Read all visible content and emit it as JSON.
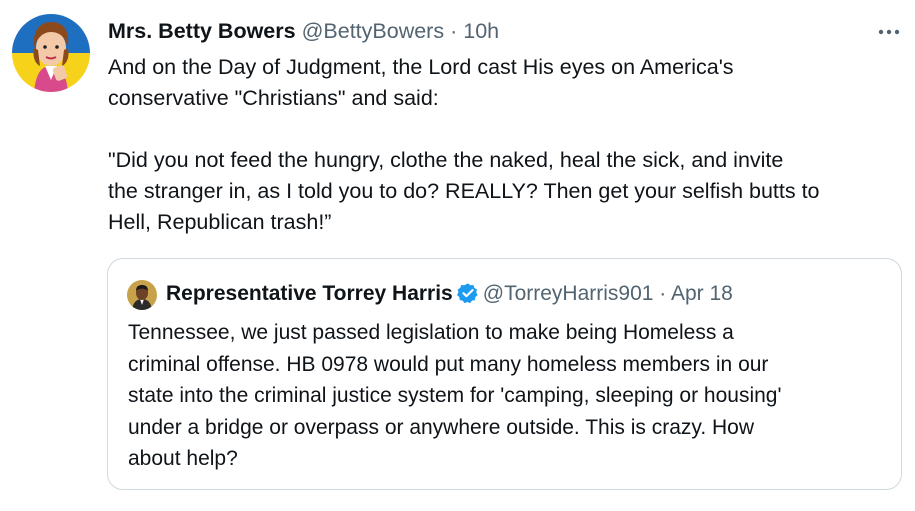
{
  "tweet": {
    "author_name": "Mrs. Betty Bowers",
    "author_handle": "@BettyBowers",
    "separator": "·",
    "time": "10h",
    "more_icon": "more-horizontal-icon",
    "text": "And on the Day of Judgment, the Lord cast His eyes on America's\nconservative \"Christians\" and said:\n\n\"Did you not feed the hungry, clothe the naked, heal the sick, and invite\nthe stranger in, as I told you to do? REALLY? Then get your selfish butts to\nHell, Republican trash!”"
  },
  "quoted": {
    "author_name": "Representative Torrey Harris",
    "verified_icon": "verified-badge-icon",
    "author_handle": "@TorreyHarris901",
    "separator": "·",
    "date": "Apr 18",
    "text": "Tennessee, we just passed legislation to make being Homeless a\ncriminal offense. HB 0978 would put many homeless members in our\nstate into the criminal justice system for 'camping, sleeping or housing'\nunder a bridge or overpass or anywhere outside. This is crazy. How\nabout help?"
  },
  "colors": {
    "text_primary": "#0f1419",
    "text_secondary": "#536471",
    "verified_blue": "#1d9bf0",
    "border": "#cfd9de"
  }
}
